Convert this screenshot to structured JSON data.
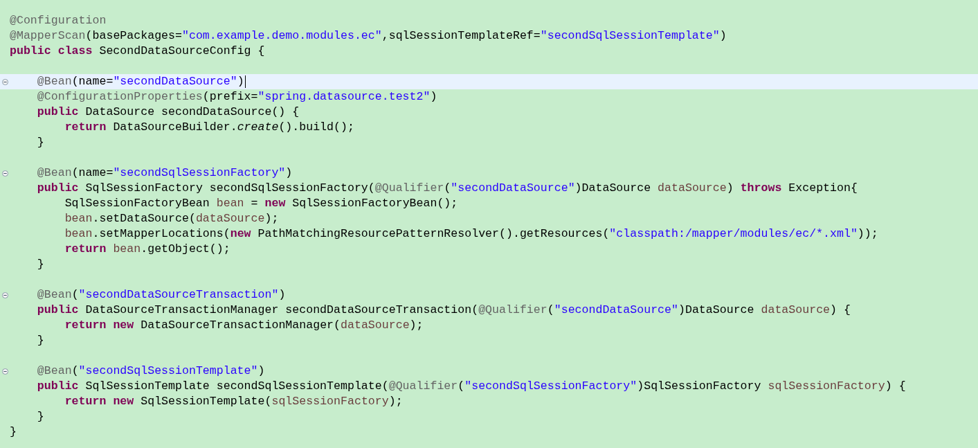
{
  "editor": {
    "lines": [
      {
        "foldable": false,
        "current": false,
        "tokens": [
          {
            "kind": "annotation",
            "text": "@Configuration"
          }
        ]
      },
      {
        "foldable": false,
        "current": false,
        "tokens": [
          {
            "kind": "annotation",
            "text": "@MapperScan"
          },
          {
            "kind": "plain",
            "text": "(basePackages="
          },
          {
            "kind": "string",
            "text": "\"com.example.demo.modules.ec\""
          },
          {
            "kind": "plain",
            "text": ",sqlSessionTemplateRef="
          },
          {
            "kind": "string",
            "text": "\"secondSqlSessionTemplate\""
          },
          {
            "kind": "plain",
            "text": ")"
          }
        ]
      },
      {
        "foldable": false,
        "current": false,
        "tokens": [
          {
            "kind": "keyword",
            "text": "public"
          },
          {
            "kind": "keyword",
            "text": " class"
          },
          {
            "kind": "plain",
            "text": " SecondDataSourceConfig {"
          }
        ]
      },
      {
        "foldable": false,
        "current": false
      },
      {
        "foldable": true,
        "current": true,
        "tokens": [
          {
            "kind": "annotation",
            "text": "    @Bean"
          },
          {
            "kind": "plain",
            "text": "(name="
          },
          {
            "kind": "string",
            "text": "\"secondDataSource\""
          },
          {
            "kind": "plain",
            "text": ")"
          }
        ]
      },
      {
        "foldable": false,
        "current": false,
        "tokens": [
          {
            "kind": "annotation",
            "text": "    @ConfigurationProperties"
          },
          {
            "kind": "plain",
            "text": "(prefix="
          },
          {
            "kind": "string",
            "text": "\"spring.datasource.test2\""
          },
          {
            "kind": "plain",
            "text": ")"
          }
        ]
      },
      {
        "foldable": false,
        "current": false,
        "tokens": [
          {
            "kind": "keyword",
            "text": "    public"
          },
          {
            "kind": "plain",
            "text": " DataSource secondDataSource() {"
          }
        ]
      },
      {
        "foldable": false,
        "current": false,
        "tokens": [
          {
            "kind": "keyword",
            "text": "        return"
          },
          {
            "kind": "plain",
            "text": " DataSourceBuilder."
          },
          {
            "kind": "method",
            "text": "create"
          },
          {
            "kind": "plain",
            "text": "().build();"
          }
        ]
      },
      {
        "foldable": false,
        "current": false,
        "tokens": [
          {
            "kind": "plain",
            "text": "    }"
          }
        ]
      },
      {
        "foldable": false,
        "current": false
      },
      {
        "foldable": true,
        "current": false,
        "tokens": [
          {
            "kind": "annotation",
            "text": "    @Bean"
          },
          {
            "kind": "plain",
            "text": "(name="
          },
          {
            "kind": "string",
            "text": "\"secondSqlSessionFactory\""
          },
          {
            "kind": "plain",
            "text": ")"
          }
        ]
      },
      {
        "foldable": false,
        "current": false,
        "tokens": [
          {
            "kind": "keyword",
            "text": "    public"
          },
          {
            "kind": "plain",
            "text": " SqlSessionFactory secondSqlSessionFactory("
          },
          {
            "kind": "annotation",
            "text": "@Qualifier"
          },
          {
            "kind": "plain",
            "text": "("
          },
          {
            "kind": "string",
            "text": "\"secondDataSource\""
          },
          {
            "kind": "plain",
            "text": ")DataSource "
          },
          {
            "kind": "variable",
            "text": "dataSource"
          },
          {
            "kind": "plain",
            "text": ") "
          },
          {
            "kind": "keyword",
            "text": "throws"
          },
          {
            "kind": "plain",
            "text": " Exception{"
          }
        ]
      },
      {
        "foldable": false,
        "current": false,
        "tokens": [
          {
            "kind": "plain",
            "text": "        SqlSessionFactoryBean "
          },
          {
            "kind": "variable",
            "text": "bean"
          },
          {
            "kind": "plain",
            "text": " = "
          },
          {
            "kind": "keyword",
            "text": "new"
          },
          {
            "kind": "plain",
            "text": " SqlSessionFactoryBean();"
          }
        ]
      },
      {
        "foldable": false,
        "current": false,
        "tokens": [
          {
            "kind": "variable",
            "text": "        bean"
          },
          {
            "kind": "plain",
            "text": ".setDataSource("
          },
          {
            "kind": "variable",
            "text": "dataSource"
          },
          {
            "kind": "plain",
            "text": ");"
          }
        ]
      },
      {
        "foldable": false,
        "current": false,
        "tokens": [
          {
            "kind": "variable",
            "text": "        bean"
          },
          {
            "kind": "plain",
            "text": ".setMapperLocations("
          },
          {
            "kind": "keyword",
            "text": "new"
          },
          {
            "kind": "plain",
            "text": " PathMatchingResourcePatternResolver().getResources("
          },
          {
            "kind": "string",
            "text": "\"classpath:/mapper/modules/ec/*.xml\""
          },
          {
            "kind": "plain",
            "text": "));"
          }
        ]
      },
      {
        "foldable": false,
        "current": false,
        "tokens": [
          {
            "kind": "keyword",
            "text": "        return"
          },
          {
            "kind": "variable",
            "text": " bean"
          },
          {
            "kind": "plain",
            "text": ".getObject();"
          }
        ]
      },
      {
        "foldable": false,
        "current": false,
        "tokens": [
          {
            "kind": "plain",
            "text": "    }"
          }
        ]
      },
      {
        "foldable": false,
        "current": false
      },
      {
        "foldable": true,
        "current": false,
        "tokens": [
          {
            "kind": "annotation",
            "text": "    @Bean"
          },
          {
            "kind": "plain",
            "text": "("
          },
          {
            "kind": "string",
            "text": "\"secondDataSourceTransaction\""
          },
          {
            "kind": "plain",
            "text": ")"
          }
        ]
      },
      {
        "foldable": false,
        "current": false,
        "tokens": [
          {
            "kind": "keyword",
            "text": "    public"
          },
          {
            "kind": "plain",
            "text": " DataSourceTransactionManager secondDataSourceTransaction("
          },
          {
            "kind": "annotation",
            "text": "@Qualifier"
          },
          {
            "kind": "plain",
            "text": "("
          },
          {
            "kind": "string",
            "text": "\"secondDataSource\""
          },
          {
            "kind": "plain",
            "text": ")DataSource "
          },
          {
            "kind": "variable",
            "text": "dataSource"
          },
          {
            "kind": "plain",
            "text": ") {"
          }
        ]
      },
      {
        "foldable": false,
        "current": false,
        "tokens": [
          {
            "kind": "keyword",
            "text": "        return"
          },
          {
            "kind": "keyword",
            "text": " new"
          },
          {
            "kind": "plain",
            "text": " DataSourceTransactionManager("
          },
          {
            "kind": "variable",
            "text": "dataSource"
          },
          {
            "kind": "plain",
            "text": ");"
          }
        ]
      },
      {
        "foldable": false,
        "current": false,
        "tokens": [
          {
            "kind": "plain",
            "text": "    }"
          }
        ]
      },
      {
        "foldable": false,
        "current": false
      },
      {
        "foldable": true,
        "current": false,
        "tokens": [
          {
            "kind": "annotation",
            "text": "    @Bean"
          },
          {
            "kind": "plain",
            "text": "("
          },
          {
            "kind": "string",
            "text": "\"secondSqlSessionTemplate\""
          },
          {
            "kind": "plain",
            "text": ")"
          }
        ]
      },
      {
        "foldable": false,
        "current": false,
        "tokens": [
          {
            "kind": "keyword",
            "text": "    public"
          },
          {
            "kind": "plain",
            "text": " SqlSessionTemplate secondSqlSessionTemplate("
          },
          {
            "kind": "annotation",
            "text": "@Qualifier"
          },
          {
            "kind": "plain",
            "text": "("
          },
          {
            "kind": "string",
            "text": "\"secondSqlSessionFactory\""
          },
          {
            "kind": "plain",
            "text": ")SqlSessionFactory "
          },
          {
            "kind": "variable",
            "text": "sqlSessionFactory"
          },
          {
            "kind": "plain",
            "text": ") {"
          }
        ]
      },
      {
        "foldable": false,
        "current": false,
        "tokens": [
          {
            "kind": "keyword",
            "text": "        return"
          },
          {
            "kind": "keyword",
            "text": " new"
          },
          {
            "kind": "plain",
            "text": " SqlSessionTemplate("
          },
          {
            "kind": "variable",
            "text": "sqlSessionFactory"
          },
          {
            "kind": "plain",
            "text": ");"
          }
        ]
      },
      {
        "foldable": false,
        "current": false,
        "tokens": [
          {
            "kind": "plain",
            "text": "    }"
          }
        ]
      },
      {
        "foldable": false,
        "current": false,
        "tokens": [
          {
            "kind": "plain",
            "text": "}"
          }
        ]
      }
    ]
  }
}
